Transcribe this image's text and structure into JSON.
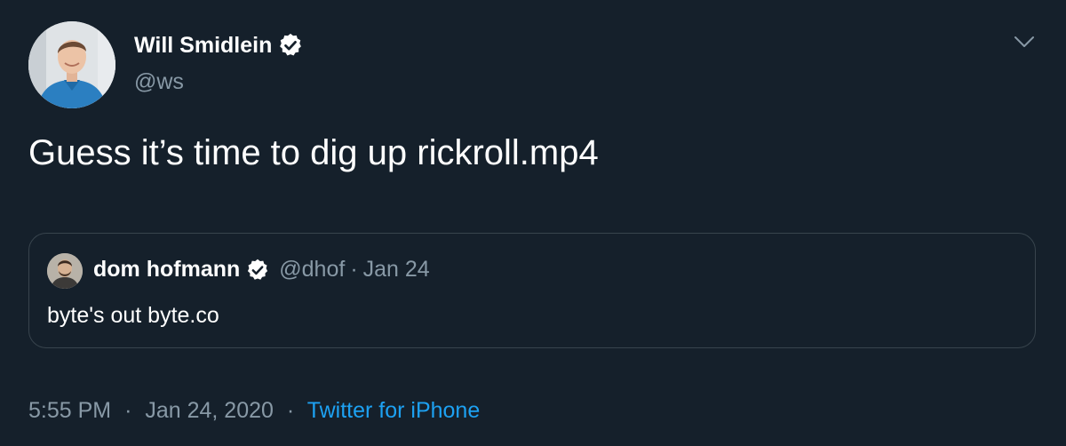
{
  "author": {
    "name": "Will Smidlein",
    "handle": "@ws",
    "verified": true
  },
  "tweet": {
    "text": "Guess it’s time to dig up rickroll.mp4"
  },
  "quoted_tweet": {
    "name": "dom hofmann",
    "handle": "@dhof",
    "separator": "·",
    "date": "Jan 24",
    "text": "byte's out byte.co",
    "verified": true
  },
  "meta": {
    "time": "5:55 PM",
    "separator": "·",
    "date": "Jan 24, 2020",
    "source": "Twitter for iPhone"
  },
  "icons": {
    "verified": "verified-badge-icon",
    "menu": "chevron-down-icon"
  },
  "colors": {
    "background": "#15202b",
    "secondary_text": "#8899a6",
    "link": "#1da1f2",
    "border": "#38444d"
  }
}
